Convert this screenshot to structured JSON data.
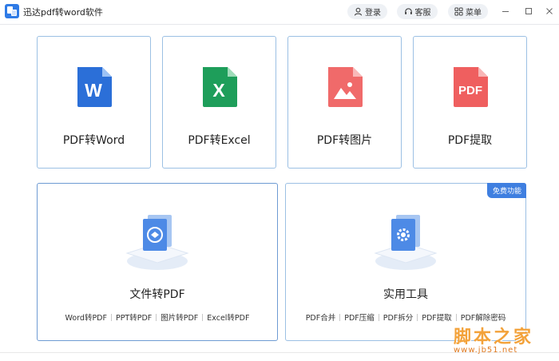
{
  "app": {
    "title": "迅达pdf转word软件"
  },
  "header": {
    "login_label": "登录",
    "service_label": "客服",
    "menu_label": "菜单"
  },
  "top_cards": [
    {
      "label": "PDF转Word",
      "icon": "word-file-icon",
      "icon_letter": "W",
      "color": "#2b6fd8"
    },
    {
      "label": "PDF转Excel",
      "icon": "excel-file-icon",
      "icon_letter": "X",
      "color": "#1e9e5a"
    },
    {
      "label": "PDF转图片",
      "icon": "image-file-icon",
      "icon_letter": "",
      "color": "#f06a6a"
    },
    {
      "label": "PDF提取",
      "icon": "pdf-file-icon",
      "icon_letter": "PDF",
      "color": "#ef5f5f"
    }
  ],
  "big_cards": [
    {
      "title": "文件转PDF",
      "icon": "file-convert-icon",
      "subs": [
        "Word转PDF",
        "PPT转PDF",
        "图片转PDF",
        "Excel转PDF"
      ]
    },
    {
      "title": "实用工具",
      "icon": "gear-tools-icon",
      "badge": "免费功能",
      "subs": [
        "PDF合并",
        "PDF压缩",
        "PDF拆分",
        "PDF提取",
        "PDF解除密码"
      ]
    }
  ],
  "watermark": {
    "text": "脚本之家",
    "url": "www.jb51.net"
  },
  "colors": {
    "accent": "#3f7fe0",
    "card_border": "#9cc0e4",
    "word": "#2b6fd8",
    "excel": "#1e9e5a",
    "image": "#f06a6a",
    "pdf": "#ef5f5f"
  }
}
